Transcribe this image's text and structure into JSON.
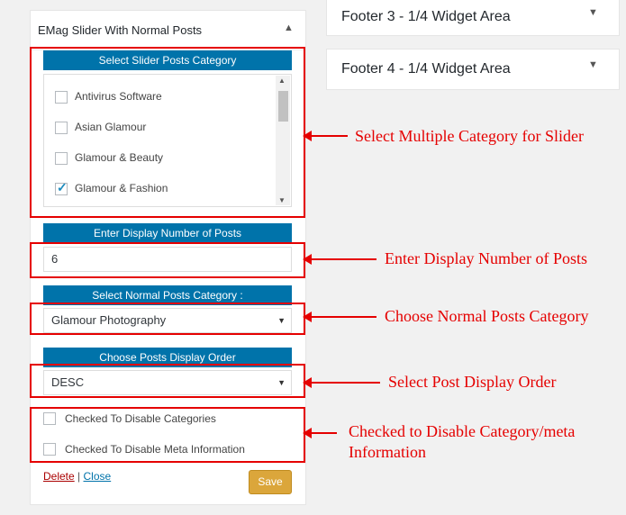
{
  "widget": {
    "title": "EMag Slider With Normal Posts",
    "slider_category_header": "Select Slider Posts Category",
    "categories": [
      {
        "label": "Antivirus Software",
        "checked": false
      },
      {
        "label": "Asian Glamour",
        "checked": false
      },
      {
        "label": "Glamour & Beauty",
        "checked": false
      },
      {
        "label": "Glamour & Fashion",
        "checked": true
      }
    ],
    "number_header": "Enter Display Number of Posts",
    "number_value": "6",
    "normal_category_header": "Select Normal Posts Category :",
    "normal_category_value": "Glamour Photography",
    "order_header": "Choose Posts Display Order",
    "order_value": "DESC",
    "disable_categories_label": "Checked To Disable Categories",
    "disable_meta_label": "Checked To Disable Meta Information",
    "delete_label": "Delete",
    "separator": "|",
    "close_label": "Close",
    "save_label": "Save"
  },
  "footer_widgets": [
    {
      "title": "Footer 3 - 1/4 Widget Area"
    },
    {
      "title": "Footer 4 - 1/4 Widget Area"
    }
  ],
  "annotations": {
    "slider_category": "Select Multiple Category for Slider",
    "number_posts": "Enter Display Number of Posts",
    "normal_category": "Choose Normal Posts Category",
    "display_order": "Select Post Display Order",
    "disable_line1": "Checked to Disable Category/meta",
    "disable_line2": "Information"
  },
  "colors": {
    "header_blue": "#0073aa",
    "highlight_red": "#e50000",
    "save_button": "#dba63b"
  }
}
